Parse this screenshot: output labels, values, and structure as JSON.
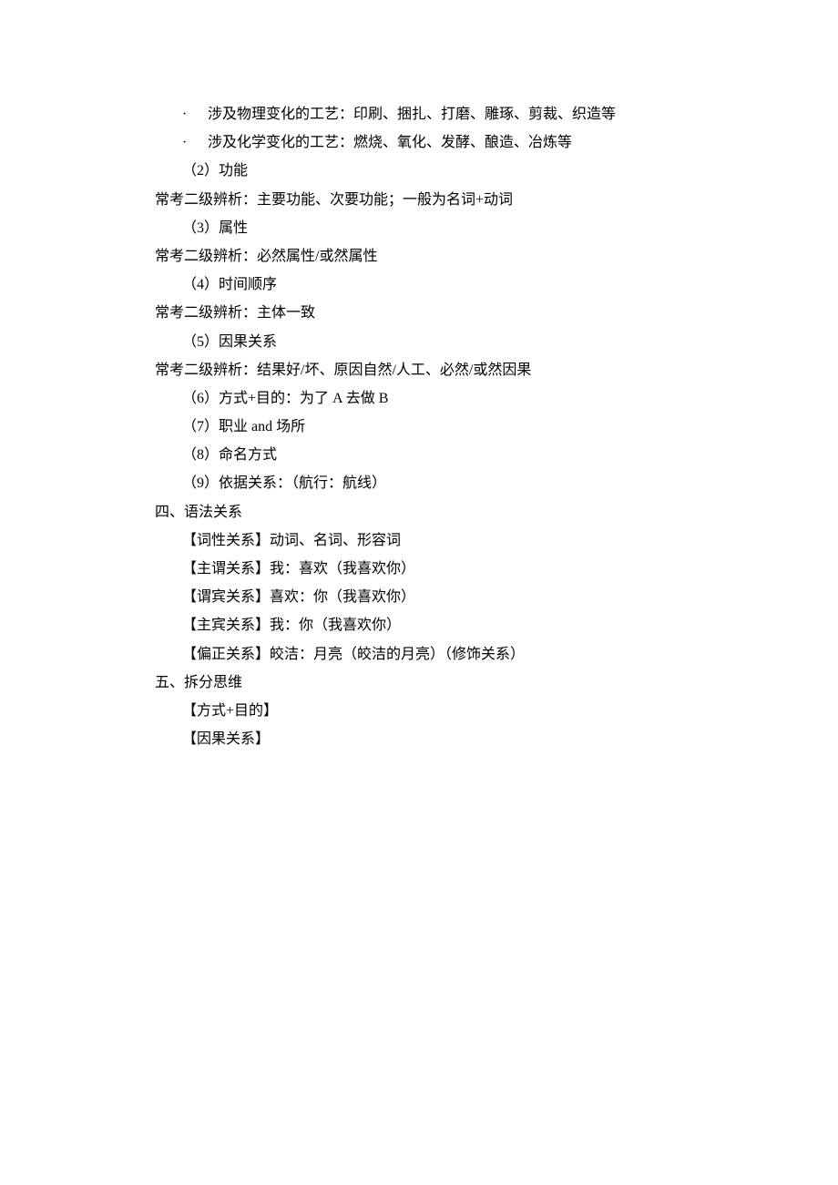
{
  "lines": [
    {
      "type": "bullet",
      "text": "涉及物理变化的工艺：印刷、捆扎、打磨、雕琢、剪裁、织造等"
    },
    {
      "type": "bullet",
      "text": "涉及化学变化的工艺：燃烧、氧化、发酵、酿造、冶炼等"
    },
    {
      "type": "indent1",
      "text": "（2）功能"
    },
    {
      "type": "indent0",
      "text": "常考二级辨析：主要功能、次要功能；一般为名词+动词"
    },
    {
      "type": "indent1",
      "text": "（3）属性"
    },
    {
      "type": "indent0",
      "text": "常考二级辨析：必然属性/或然属性"
    },
    {
      "type": "indent1",
      "text": "（4）时间顺序"
    },
    {
      "type": "indent0",
      "text": "常考二级辨析：主体一致"
    },
    {
      "type": "indent1",
      "text": "（5）因果关系"
    },
    {
      "type": "indent0",
      "text": "常考二级辨析：结果好/坏、原因自然/人工、必然/或然因果"
    },
    {
      "type": "indent1",
      "text": "（6）方式+目的：为了 A 去做 B"
    },
    {
      "type": "indent1",
      "text": "（7）职业 and 场所"
    },
    {
      "type": "indent1",
      "text": "（8）命名方式"
    },
    {
      "type": "indent1",
      "text": "（9）依据关系：（航行：航线）"
    },
    {
      "type": "indent0",
      "text": "四、语法关系"
    },
    {
      "type": "indent1",
      "text": "【词性关系】动词、名词、形容词"
    },
    {
      "type": "indent1",
      "text": "【主谓关系】我：喜欢（我喜欢你）"
    },
    {
      "type": "indent1",
      "text": "【谓宾关系】喜欢：你（我喜欢你）"
    },
    {
      "type": "indent1",
      "text": "【主宾关系】我：你（我喜欢你）"
    },
    {
      "type": "indent1",
      "text": "【偏正关系】皎洁：月亮（皎洁的月亮）（修饰关系）"
    },
    {
      "type": "indent0",
      "text": "五、拆分思维"
    },
    {
      "type": "indent1",
      "text": "【方式+目的】"
    },
    {
      "type": "indent1",
      "text": "【因果关系】"
    }
  ],
  "bullet_char": "·"
}
